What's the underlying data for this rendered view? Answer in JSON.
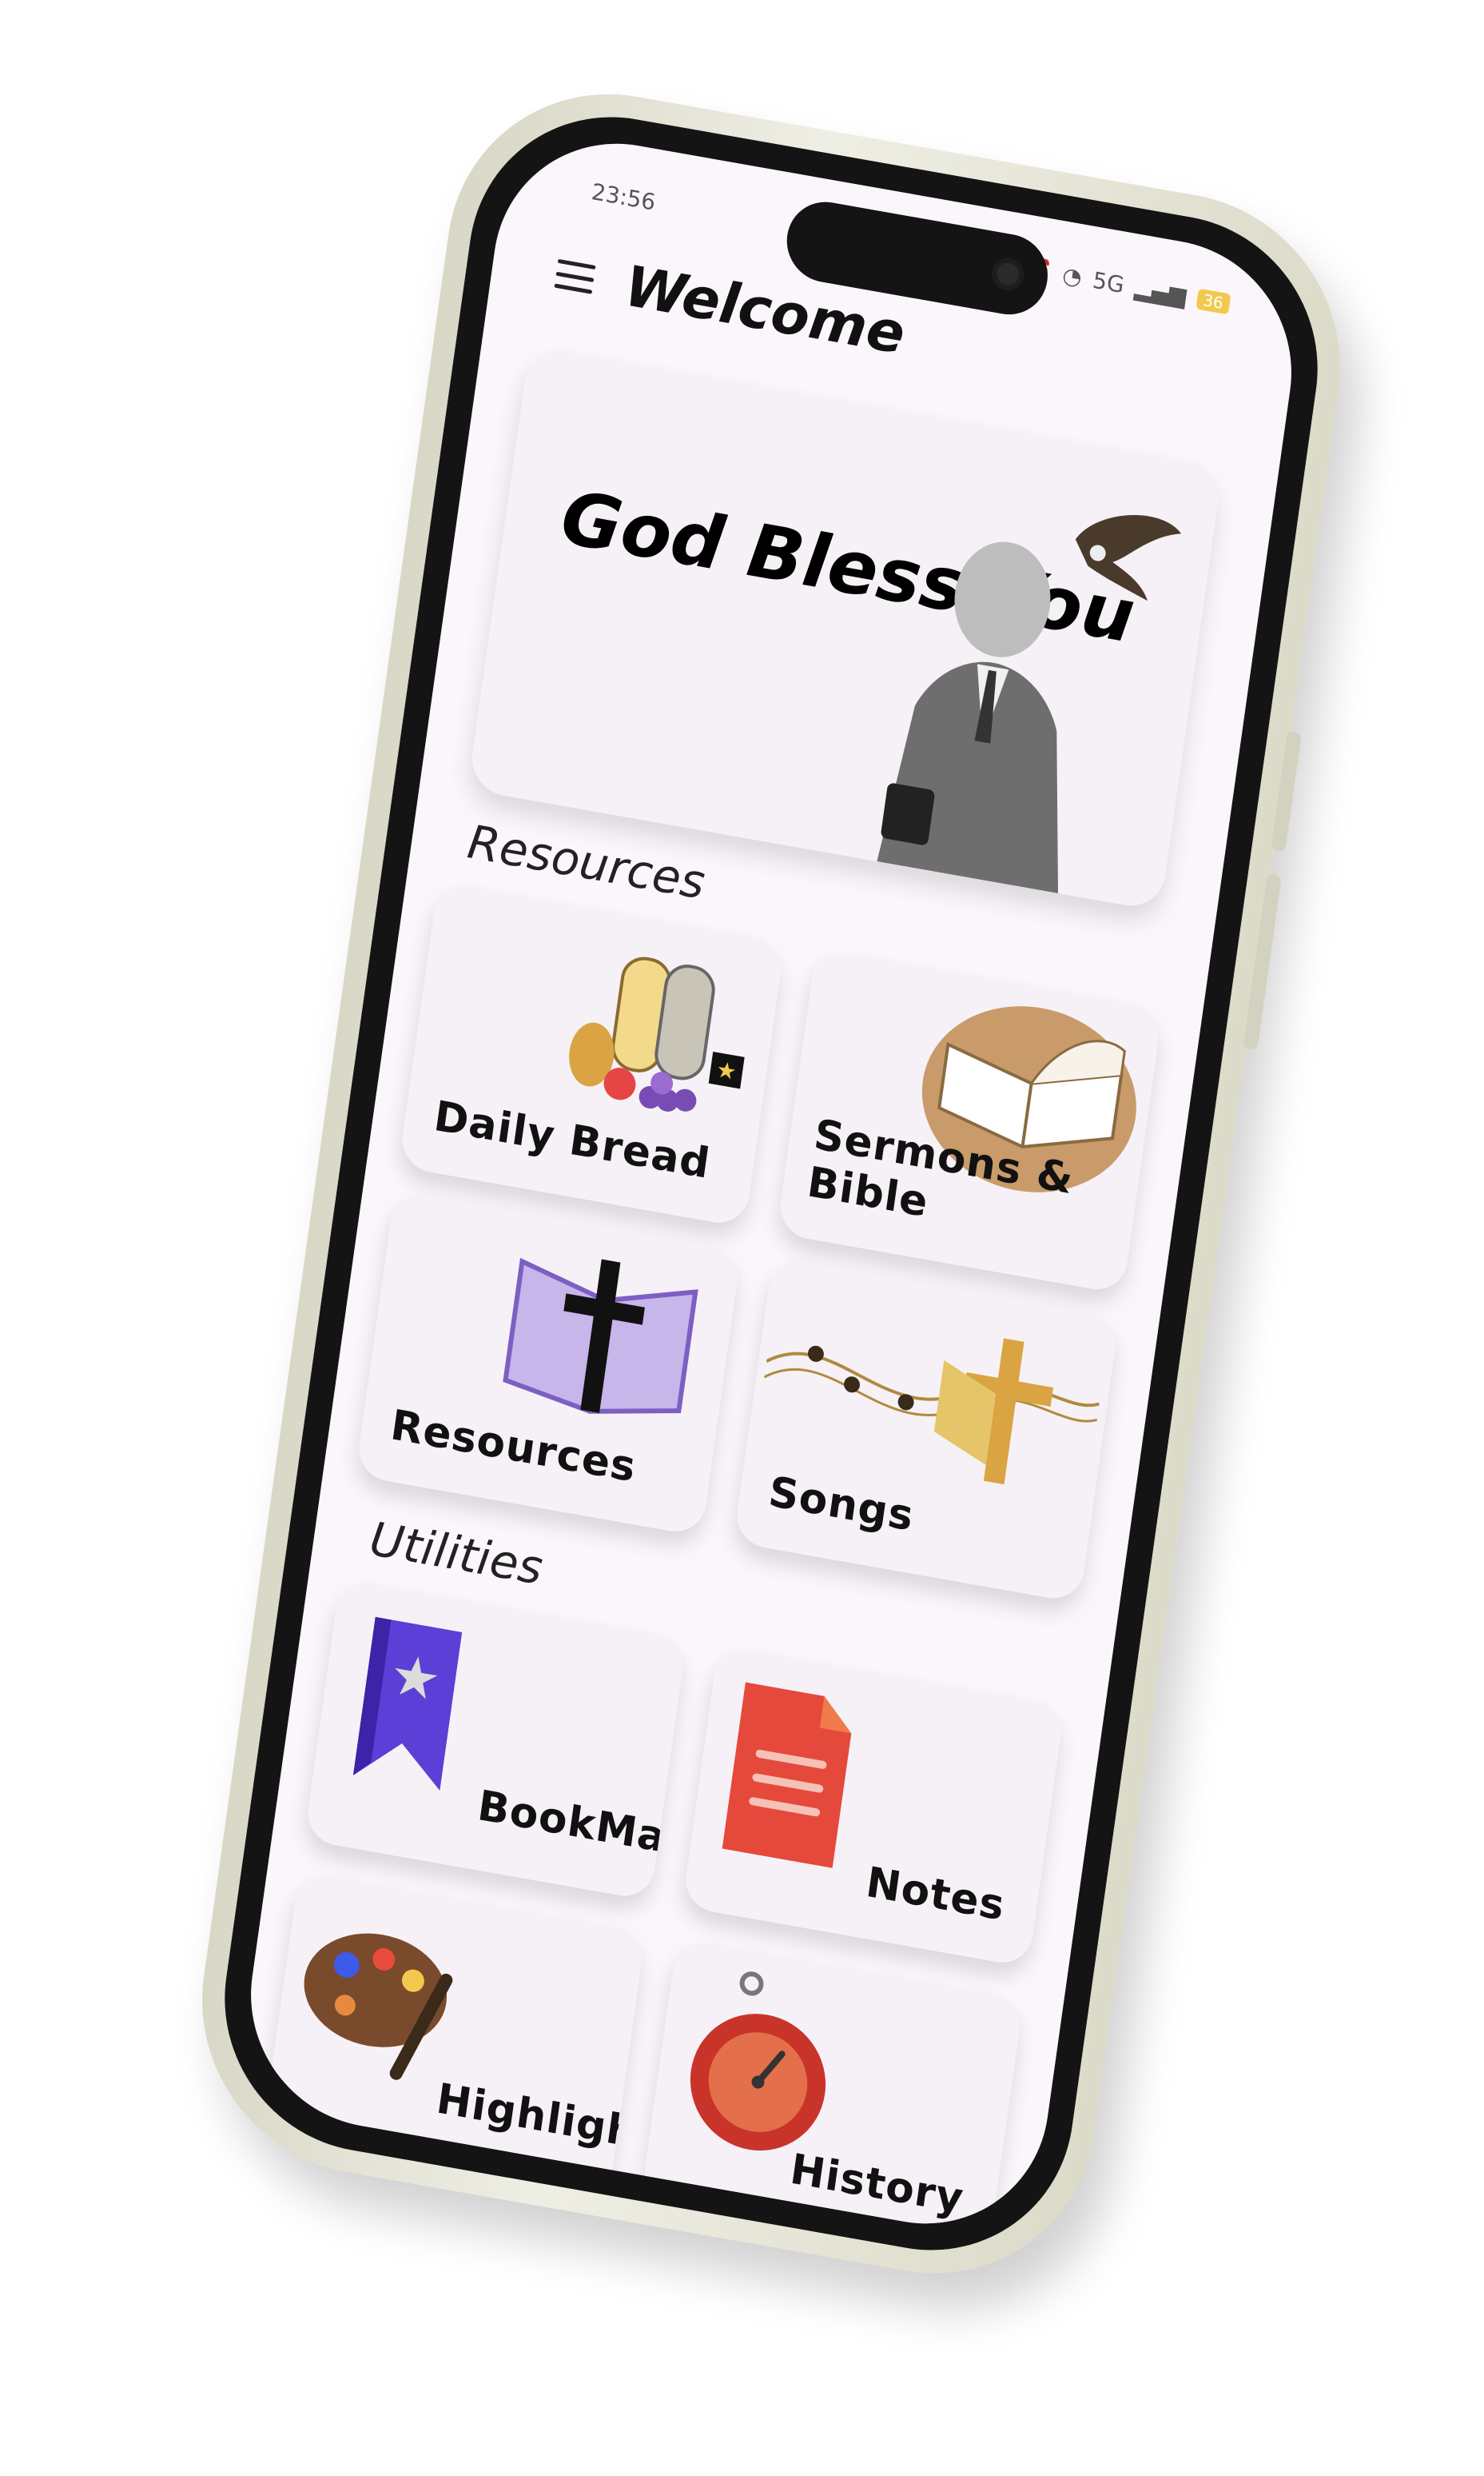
{
  "statusbar": {
    "time": "23:56",
    "network": "5G",
    "battery": "36"
  },
  "appbar": {
    "title": "Welcome"
  },
  "hero": {
    "text": "God Bless You"
  },
  "sections": {
    "resources_title": "Resources",
    "utilities_title": "Utilities"
  },
  "cards": {
    "daily_bread": "Daily Bread",
    "sermons_bible": "Sermons & Bible",
    "resources": "Resources",
    "songs": "Songs",
    "bookmark": "BookMark",
    "notes": "Notes",
    "highlights": "Highlights",
    "history": "History"
  },
  "colors": {
    "screen_bg": "#fbf6fb",
    "card_bg": "#f6f1f6",
    "frame": "#e6e4d4"
  }
}
